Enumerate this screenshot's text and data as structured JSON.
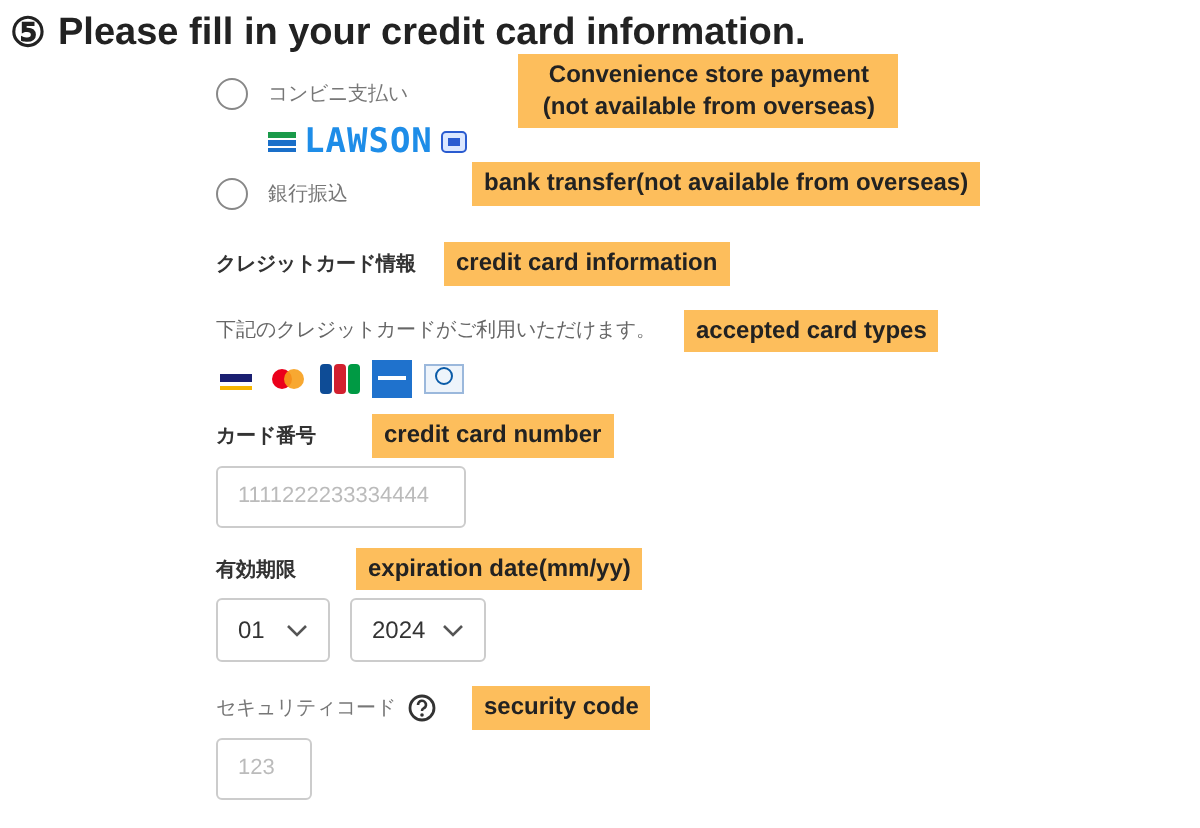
{
  "title": {
    "number": "⑤",
    "text": "Please fill in your credit card information."
  },
  "payment_options": [
    {
      "label": "コンビニ支払い",
      "selected": false,
      "logo": "LAWSON",
      "note": [
        "Convenience store payment",
        "(not available from overseas)"
      ]
    },
    {
      "label": "銀行振込",
      "selected": false,
      "note": [
        "bank transfer(not available from overseas)"
      ]
    }
  ],
  "credit_card": {
    "heading": "クレジットカード情報",
    "heading_note": "credit card information",
    "accepted_text": "下記のクレジットカードがご利用いただけます。",
    "accepted_note": "accepted card types",
    "cards": [
      {
        "kind": "visa"
      },
      {
        "kind": "master"
      },
      {
        "kind": "jcb"
      },
      {
        "kind": "amex"
      },
      {
        "kind": "diners"
      }
    ],
    "number": {
      "label": "カード番号",
      "placeholder": "1111222233334444",
      "note": "credit card number"
    },
    "expiry": {
      "label": "有効期限",
      "month": "01",
      "year": "2024",
      "note": "expiration date(mm/yy)"
    },
    "security": {
      "label": "セキュリティコード",
      "placeholder": "123",
      "note": "security code"
    }
  }
}
